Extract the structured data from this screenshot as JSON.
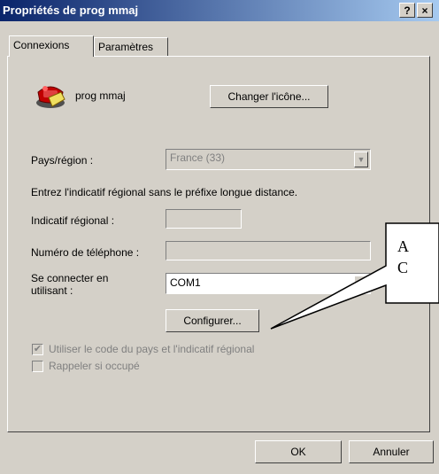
{
  "window": {
    "title": "Propriétés de prog mmaj",
    "help_glyph": "?",
    "close_glyph": "×"
  },
  "tabs": [
    {
      "label": "Connexions"
    },
    {
      "label": "Paramètres"
    }
  ],
  "connection": {
    "name": "prog mmaj",
    "icon": "telephone-icon",
    "change_icon_label": "Changer l'icône..."
  },
  "country": {
    "label": "Pays/région :",
    "value": "France (33)"
  },
  "instruction": "Entrez l'indicatif régional sans le préfixe longue distance.",
  "area_code": {
    "label": "Indicatif régional :",
    "value": ""
  },
  "phone": {
    "label": "Numéro de téléphone :",
    "value": ""
  },
  "connect_using": {
    "label_line1": "Se connecter en",
    "label_line2": "utilisant :",
    "value": "COM1"
  },
  "configure_label": "Configurer...",
  "checkboxes": [
    {
      "label": "Utiliser le code du pays et l'indicatif régional",
      "checked": true,
      "enabled": false
    },
    {
      "label": "Rappeler si occupé",
      "checked": false,
      "enabled": false
    }
  ],
  "buttons": {
    "ok": "OK",
    "cancel": "Annuler"
  },
  "callout": {
    "line1": "A",
    "line2": "C"
  }
}
